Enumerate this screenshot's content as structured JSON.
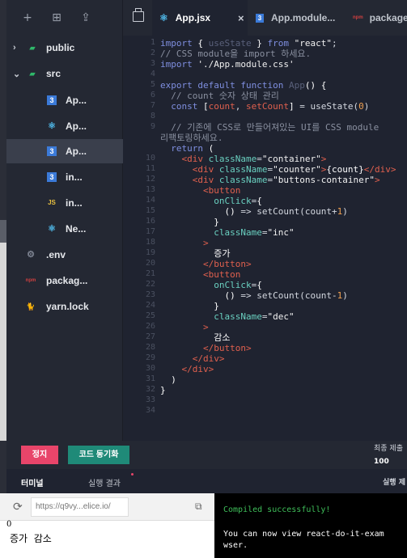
{
  "colors": {
    "editor_bg": "#1f2330",
    "sidebar_bg": "#242833",
    "keyword": "#7f8fe0",
    "tag": "#e0604e",
    "attr": "#6ad0c0",
    "stop_button": "#e8456a",
    "sync_button": "#1f8a78",
    "terminal_ok": "#3fbf5a"
  },
  "sidebar": {
    "tools": [
      "new-file-icon",
      "new-folder-icon",
      "upload-icon"
    ],
    "items": [
      {
        "label": "public",
        "icon": "folder-icon",
        "expanded": false
      },
      {
        "label": "src",
        "icon": "folder-icon",
        "expanded": true
      },
      {
        "label": "Ap...",
        "icon": "css-icon",
        "badge": "3"
      },
      {
        "label": "Ap...",
        "icon": "react-icon",
        "badge": "⚛"
      },
      {
        "label": "Ap...",
        "icon": "css-icon",
        "badge": "3",
        "selected": true
      },
      {
        "label": "in...",
        "icon": "css-icon",
        "badge": "3"
      },
      {
        "label": "in...",
        "icon": "js-icon",
        "badge": "JS"
      },
      {
        "label": "Ne...",
        "icon": "react-icon",
        "badge": "⚛"
      },
      {
        "label": ".env",
        "icon": "gear-icon",
        "badge": "⚙"
      },
      {
        "label": "packag...",
        "icon": "npm-icon",
        "badge": "npm"
      },
      {
        "label": "yarn.lock",
        "icon": "yarn-icon",
        "badge": "🐈"
      }
    ]
  },
  "tabs": [
    {
      "label": "App.jsx",
      "icon": "react-icon",
      "badge": "⚛",
      "active": true,
      "close": "×"
    },
    {
      "label": "App.module...",
      "icon": "css-icon",
      "badge": "3",
      "active": false
    },
    {
      "label": "package.",
      "icon": "npm-icon",
      "badge": "npm",
      "active": false
    }
  ],
  "editor": {
    "line_numbers": [
      "1",
      "2",
      "3",
      "4",
      "5",
      "6",
      "7",
      "8",
      "9",
      "10",
      "11",
      "12",
      "13",
      "14",
      "15",
      "16",
      "17",
      "18",
      "19",
      "20",
      "21",
      "22",
      "23",
      "24",
      "25",
      "26",
      "27",
      "28",
      "29",
      "30",
      "31",
      "32",
      "33",
      "34"
    ]
  },
  "toolbar": {
    "stop_label": "정지",
    "sync_label": "코드 동기화",
    "stat_label": "최종 제출",
    "stat_value": "100"
  },
  "panel": {
    "tab_terminal": "터미널",
    "tab_result": "실행 결과",
    "right_label": "실행 제"
  },
  "preview": {
    "url": "https://q9vy...elice.io/",
    "count": "0",
    "buttons": "증가  감소"
  },
  "terminal": {
    "line1": "Compiled successfully!",
    "line2": "You can now view react-do-it-exam",
    "line3": "wser."
  }
}
